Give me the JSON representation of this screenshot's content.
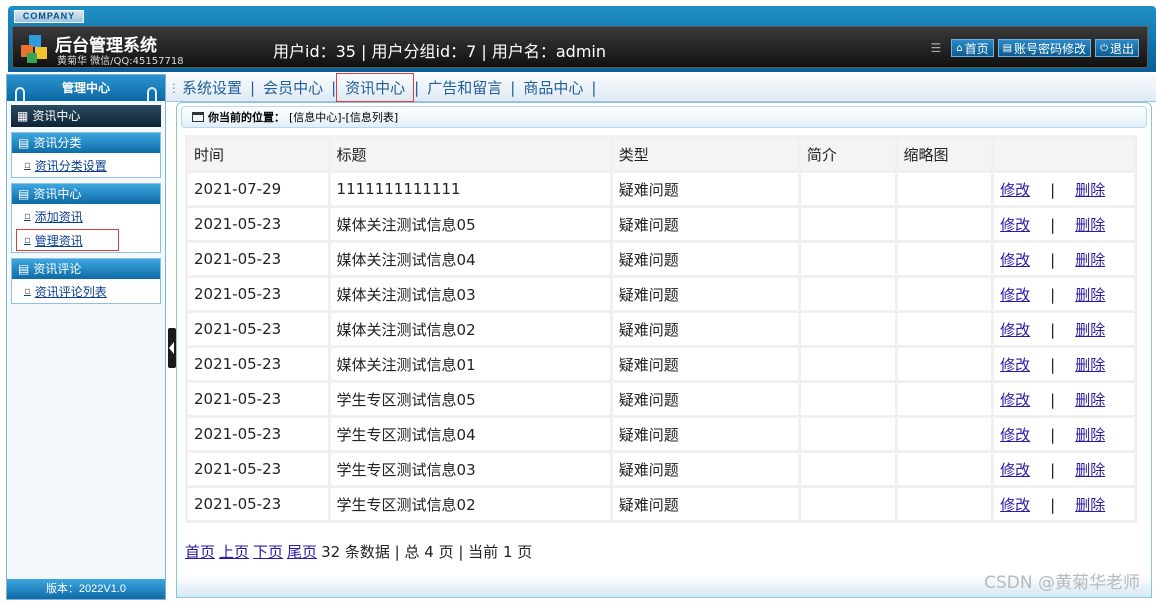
{
  "header": {
    "company": "COMPANY",
    "title": "后台管理系统",
    "subtitle": "黄菊华 微信/QQ:45157718",
    "user_info": "用户id：35 | 用户分组id：7 | 用户名：admin",
    "links": [
      "首页",
      "账号密码修改",
      "退出"
    ]
  },
  "sidebar": {
    "head": "管理中心",
    "active": "资讯中心",
    "groups": [
      {
        "title": "资讯分类",
        "items": [
          "资讯分类设置"
        ]
      },
      {
        "title": "资讯中心",
        "items": [
          "添加资讯",
          "管理资讯"
        ]
      },
      {
        "title": "资讯评论",
        "items": [
          "资讯评论列表"
        ]
      }
    ],
    "version": "版本：2022V1.0"
  },
  "topnav": [
    "系统设置",
    "会员中心",
    "资讯中心",
    "广告和留言",
    "商品中心"
  ],
  "breadcrumb": {
    "label": "你当前的位置：",
    "path": "[信息中心]-[信息列表]"
  },
  "table": {
    "headers": [
      "时间",
      "标题",
      "类型",
      "简介",
      "缩略图",
      ""
    ],
    "edit_label": "修改",
    "delete_label": "删除",
    "rows": [
      {
        "time": "2021-07-29",
        "title": "1111111111111",
        "type": "疑难问题",
        "intro": "",
        "thumb": ""
      },
      {
        "time": "2021-05-23",
        "title": "媒体关注测试信息05",
        "type": "疑难问题",
        "intro": "",
        "thumb": ""
      },
      {
        "time": "2021-05-23",
        "title": "媒体关注测试信息04",
        "type": "疑难问题",
        "intro": "",
        "thumb": ""
      },
      {
        "time": "2021-05-23",
        "title": "媒体关注测试信息03",
        "type": "疑难问题",
        "intro": "",
        "thumb": ""
      },
      {
        "time": "2021-05-23",
        "title": "媒体关注测试信息02",
        "type": "疑难问题",
        "intro": "",
        "thumb": ""
      },
      {
        "time": "2021-05-23",
        "title": "媒体关注测试信息01",
        "type": "疑难问题",
        "intro": "",
        "thumb": ""
      },
      {
        "time": "2021-05-23",
        "title": "学生专区测试信息05",
        "type": "疑难问题",
        "intro": "",
        "thumb": ""
      },
      {
        "time": "2021-05-23",
        "title": "学生专区测试信息04",
        "type": "疑难问题",
        "intro": "",
        "thumb": ""
      },
      {
        "time": "2021-05-23",
        "title": "学生专区测试信息03",
        "type": "疑难问题",
        "intro": "",
        "thumb": ""
      },
      {
        "time": "2021-05-23",
        "title": "学生专区测试信息02",
        "type": "疑难问题",
        "intro": "",
        "thumb": ""
      }
    ]
  },
  "pager": {
    "first": "首页",
    "prev": "上页",
    "next": "下页",
    "last": "尾页",
    "info": "32 条数据 | 总 4 页 | 当前 1 页"
  },
  "watermark": "CSDN @黄菊华老师",
  "icons": {
    "home": "home-icon",
    "book": "book-icon",
    "power": "power-icon"
  },
  "colors": {
    "header_blue": "#0a5f95",
    "link": "#2a1aa8",
    "highlight": "#e23b3b"
  }
}
